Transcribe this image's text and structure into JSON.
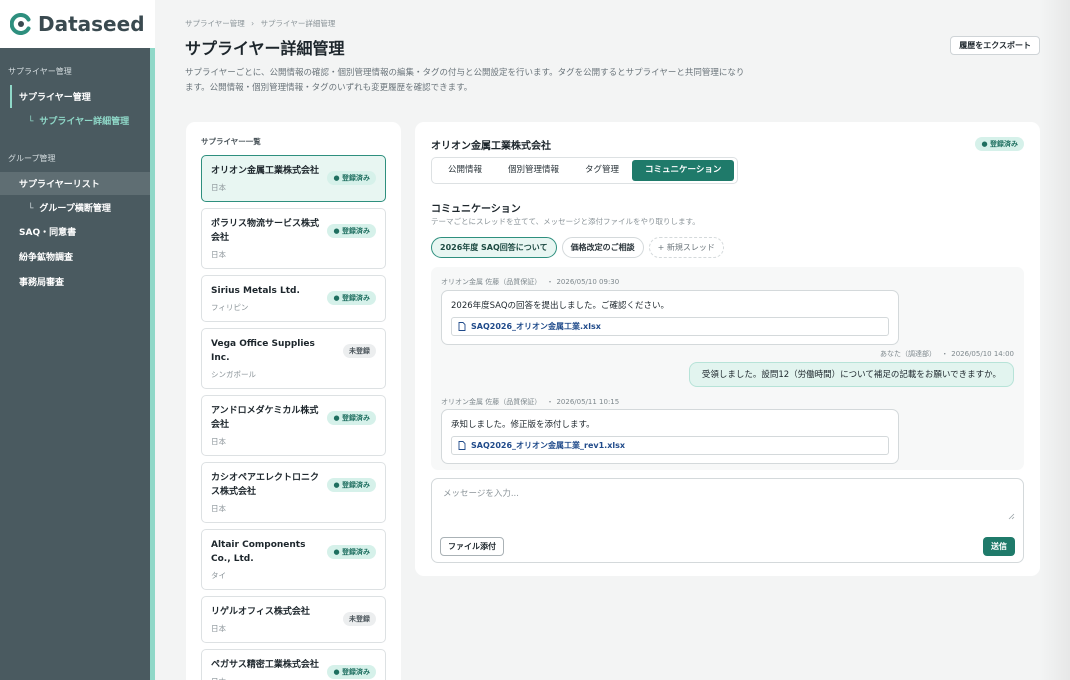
{
  "app": {
    "name": "Dataseed"
  },
  "sidebar": {
    "sections": [
      {
        "label": "サプライヤー管理",
        "items": [
          {
            "label": "サプライヤー管理"
          }
        ],
        "subitems": [
          {
            "label": "サプライヤー詳細管理"
          }
        ]
      },
      {
        "label": "グループ管理",
        "items": [
          {
            "label": "サプライヤーリスト"
          },
          {
            "label": "SAQ・同意書"
          },
          {
            "label": "紛争鉱物調査"
          },
          {
            "label": "事務局審査"
          }
        ],
        "subitems": [
          {
            "label": "グループ横断管理"
          }
        ]
      }
    ]
  },
  "header": {
    "breadcrumb": [
      "サプライヤー管理",
      "サプライヤー詳細管理"
    ],
    "breadcrumb_sep": "›",
    "title": "サプライヤー詳細管理",
    "description": "サプライヤーごとに、公開情報の確認・個別管理情報の編集・タグの付与と公開設定を行います。タグを公開するとサプライヤーと共同管理になります。公開情報・個別管理情報・タグのいずれも変更履歴を確認できます。",
    "export_label": "履歴をエクスポート"
  },
  "supplier_list": {
    "heading": "サプライヤー一覧",
    "items": [
      {
        "name": "オリオン金属工業株式会社",
        "country": "日本",
        "status": "● 登録済み",
        "registered": true
      },
      {
        "name": "ポラリス物流サービス株式会社",
        "country": "日本",
        "status": "● 登録済み",
        "registered": true
      },
      {
        "name": "Sirius Metals Ltd.",
        "country": "フィリピン",
        "status": "● 登録済み",
        "registered": true
      },
      {
        "name": "Vega Office Supplies Inc.",
        "country": "シンガポール",
        "status": "未登録",
        "registered": false
      },
      {
        "name": "アンドロメダケミカル株式会社",
        "country": "日本",
        "status": "● 登録済み",
        "registered": true
      },
      {
        "name": "カシオペアエレクトロニクス株式会社",
        "country": "日本",
        "status": "● 登録済み",
        "registered": true
      },
      {
        "name": "Altair Components Co., Ltd.",
        "country": "タイ",
        "status": "● 登録済み",
        "registered": true
      },
      {
        "name": "リゲルオフィス株式会社",
        "country": "日本",
        "status": "未登録",
        "registered": false
      },
      {
        "name": "ペガサス精密工業株式会社",
        "country": "日本",
        "status": "● 登録済み",
        "registered": true
      }
    ]
  },
  "detail": {
    "name": "オリオン金属工業株式会社",
    "status": "● 登録済み",
    "tabs": [
      "公開情報",
      "個別管理情報",
      "タグ管理",
      "コミュニケーション"
    ],
    "active_tab": 3,
    "section_title": "コミュニケーション",
    "section_desc": "テーマごとにスレッドを立てて、メッセージと添付ファイルをやり取りします。",
    "threads": [
      "2026年度 SAQ回答について",
      "価格改定のご相談",
      "+ 新規スレッド"
    ],
    "messages": [
      {
        "author": "オリオン金属 佐藤（品質保証）",
        "time": "2026/05/10 09:30",
        "text": "2026年度SAQの回答を提出しました。ご確認ください。",
        "file": "SAQ2026_オリオン金属工業.xlsx"
      },
      {
        "author": "あなた（調達部）",
        "time": "2026/05/10 14:00",
        "text": "受領しました。設問12（労働時間）について補足の記載をお願いできますか。"
      },
      {
        "author": "オリオン金属 佐藤（品質保証）",
        "time": "2026/05/11 10:15",
        "text": "承知しました。修正版を添付します。",
        "file": "SAQ2026_オリオン金属工業_rev1.xlsx"
      }
    ],
    "meta_sep": "・",
    "composer": {
      "placeholder": "メッセージを入力...",
      "attach_label": "ファイル添付",
      "send_label": "送信"
    }
  }
}
